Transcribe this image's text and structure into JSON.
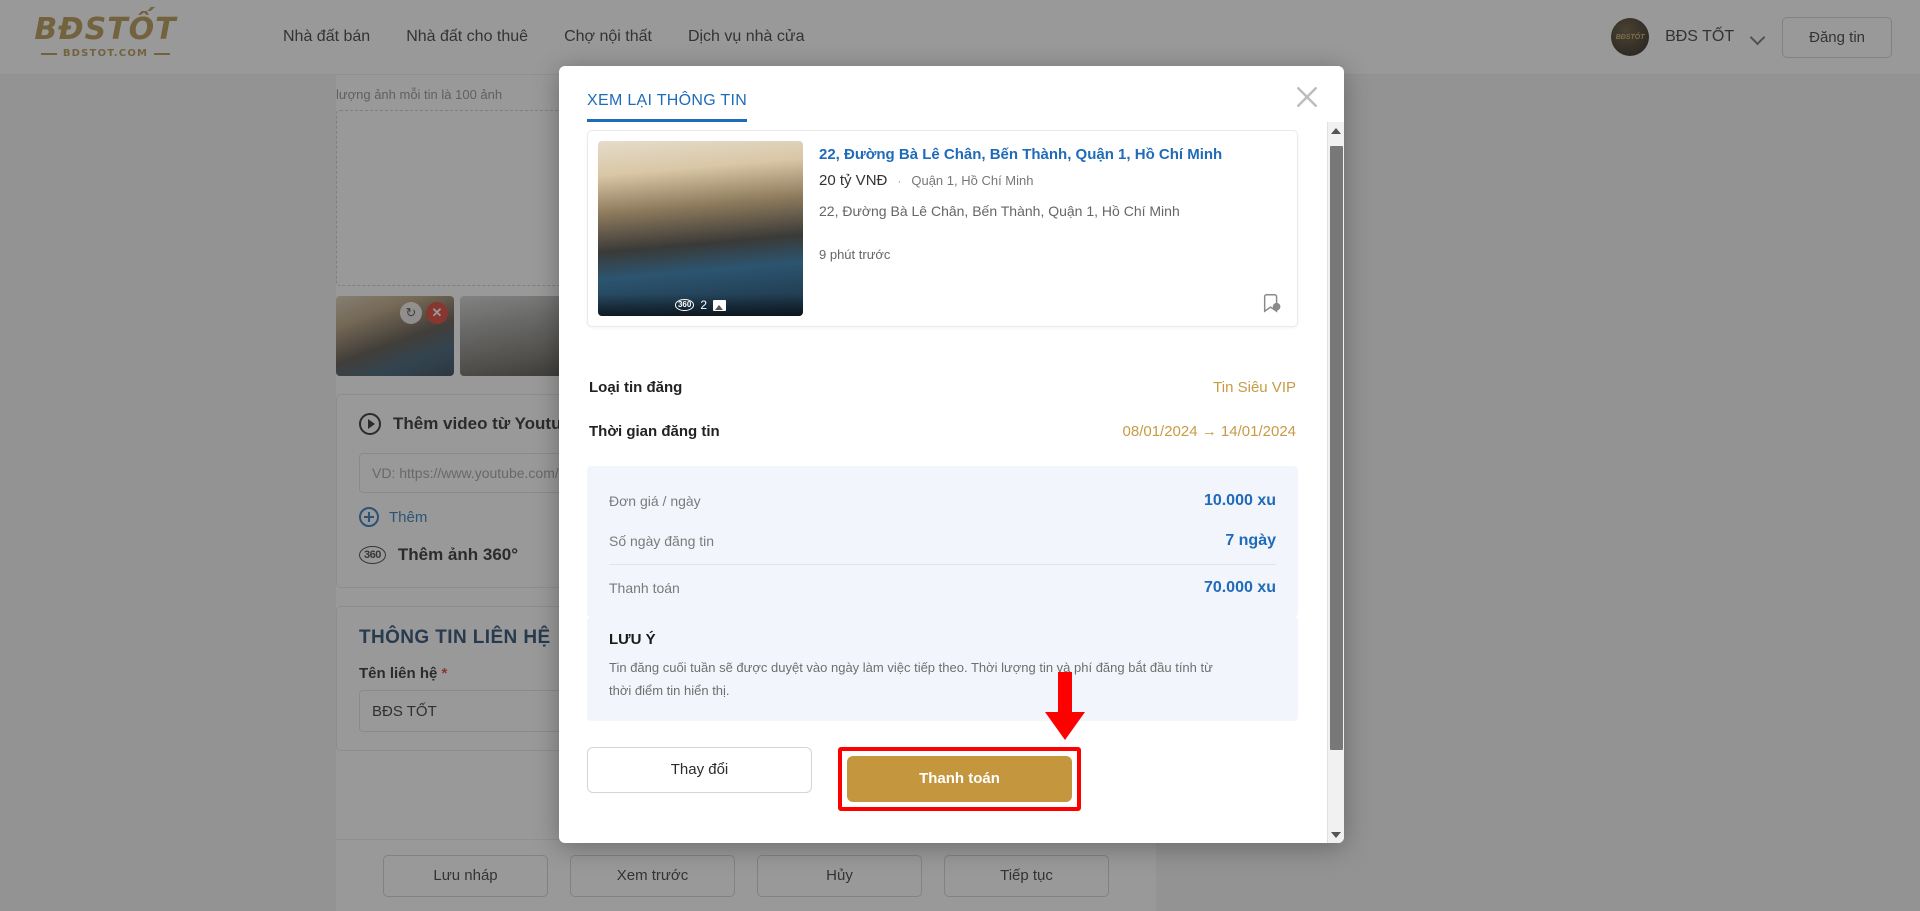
{
  "header": {
    "logo_main": "BĐSTỐT",
    "logo_sub": "BDSTOT.COM",
    "nav": [
      {
        "label": "Nhà đất bán"
      },
      {
        "label": "Nhà đất cho thuê"
      },
      {
        "label": "Chợ nội thất"
      },
      {
        "label": "Dịch vụ nhà cửa"
      }
    ],
    "user_name": "BĐS TỐT",
    "avatar_text": "BĐSTỐT",
    "chevron_icon": "chevron-down-icon",
    "post_button": "Đăng tin"
  },
  "background_form": {
    "photo_hint": "lượng ảnh mỗi tin là 100 ảnh",
    "youtube_section_title": "Thêm video từ Youtube",
    "youtube_placeholder": "VD: https://www.youtube.com/",
    "add_label": "Thêm",
    "photo360_label": "Thêm ảnh 360°",
    "contact_section_title": "THÔNG TIN LIÊN HỆ",
    "contact_name_label": "Tên liên hệ",
    "contact_name_required": "*",
    "contact_name_value": "BĐS TỐT",
    "bottom_buttons": [
      {
        "label": "Lưu nháp"
      },
      {
        "label": "Xem trước"
      },
      {
        "label": "Hủy"
      },
      {
        "label": "Tiếp tục"
      }
    ]
  },
  "modal": {
    "tab_label": "XEM LẠI THÔNG TIN",
    "close_icon": "close-icon",
    "listing": {
      "title": "22, Đường Bà Lê Chân, Bến Thành, Quận 1, Hồ Chí Minh",
      "price": "20 tỷ VNĐ",
      "separator": "·",
      "location": "Quận 1, Hồ Chí Minh",
      "address": "22, Đường Bà Lê Chân, Bến Thành, Quận 1, Hồ Chí Minh",
      "time_ago": "9 phút trước",
      "photo_count": "2",
      "badge_360": "360",
      "bookmark_icon": "bookmark-location-icon"
    },
    "details": [
      {
        "label": "Loại tin đăng",
        "value": "Tin Siêu VIP"
      },
      {
        "label": "Thời gian đăng tin",
        "value": "08/01/2024 → 14/01/2024"
      }
    ],
    "pricing": [
      {
        "label": "Đơn giá / ngày",
        "value": "10.000 xu"
      },
      {
        "label": "Số ngày đăng tin",
        "value": "7 ngày"
      },
      {
        "label": "Thanh toán",
        "value": "70.000 xu"
      }
    ],
    "note": {
      "title": "LƯU Ý",
      "text": "Tin đăng cuối tuần sẽ được duyệt vào ngày làm việc tiếp theo. Thời lượng tin và phí đăng bắt đầu tính từ thời điểm tin hiển thị."
    },
    "actions": {
      "secondary": "Thay đổi",
      "primary": "Thanh toán"
    }
  },
  "colors": {
    "brand_gold": "#b08c42",
    "link_blue": "#1f6bb8",
    "value_gold": "#c79b46",
    "price_blue": "#1f6bb8",
    "primary_button": "#c4973f",
    "highlight_red": "#ff0000"
  }
}
